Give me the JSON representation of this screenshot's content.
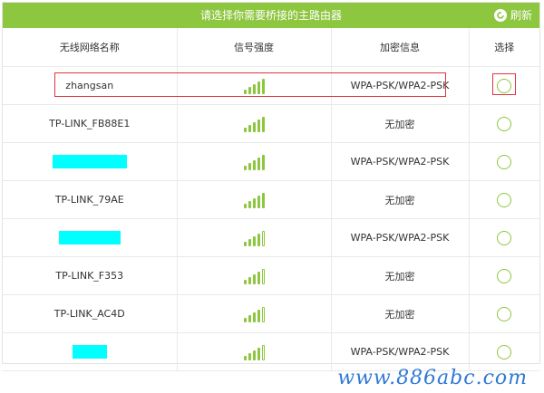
{
  "header": {
    "title": "请选择你需要桥接的主路由器",
    "refresh_label": "刷新"
  },
  "columns": {
    "name": "无线网络名称",
    "signal": "信号强度",
    "encryption": "加密信息",
    "select": "选择"
  },
  "rows": [
    {
      "ssid": "zhangsan",
      "encryption": "WPA-PSK/WPA2-PSK",
      "signal_level": 5,
      "masked": false
    },
    {
      "ssid": "TP-LINK_FB88E1",
      "encryption": "无加密",
      "signal_level": 5,
      "masked": false
    },
    {
      "ssid": "",
      "encryption": "WPA-PSK/WPA2-PSK",
      "signal_level": 5,
      "masked": true,
      "mask_width": 82
    },
    {
      "ssid": "TP-LINK_79AE",
      "encryption": "无加密",
      "signal_level": 5,
      "masked": false
    },
    {
      "ssid": "",
      "encryption": "WPA-PSK/WPA2-PSK",
      "signal_level": 4,
      "masked": true,
      "mask_width": 68
    },
    {
      "ssid": "TP-LINK_F353",
      "encryption": "无加密",
      "signal_level": 4,
      "masked": false
    },
    {
      "ssid": "TP-LINK_AC4D",
      "encryption": "无加密",
      "signal_level": 4,
      "masked": false
    },
    {
      "ssid": "",
      "encryption": "WPA-PSK/WPA2-PSK",
      "signal_level": 4,
      "masked": true,
      "mask_width": 38
    }
  ],
  "watermark": "www.886abc.com",
  "colors": {
    "accent": "#8dc63f",
    "highlight": "#e0353b",
    "mask": "#00ffff"
  }
}
